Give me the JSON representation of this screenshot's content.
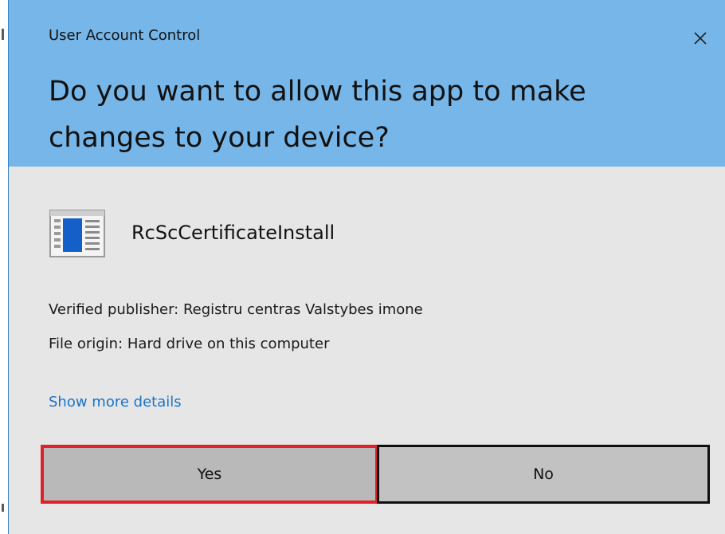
{
  "window": {
    "title": "User Account Control",
    "close_icon": "close-icon"
  },
  "prompt": {
    "question": "Do you want to allow this app to make changes to your device?"
  },
  "app": {
    "icon": "application-window-icon",
    "name": "RcScCertificateInstall"
  },
  "details": {
    "publisher": "Verified publisher: Registru centras Valstybes imone",
    "origin": "File origin: Hard drive on this computer"
  },
  "link": {
    "show_more": "Show more details"
  },
  "buttons": {
    "yes": "Yes",
    "no": "No"
  },
  "colors": {
    "header": "#77b6e8",
    "body": "#e6e6e6",
    "link": "#1a73c9",
    "highlight": "#e0202a"
  }
}
